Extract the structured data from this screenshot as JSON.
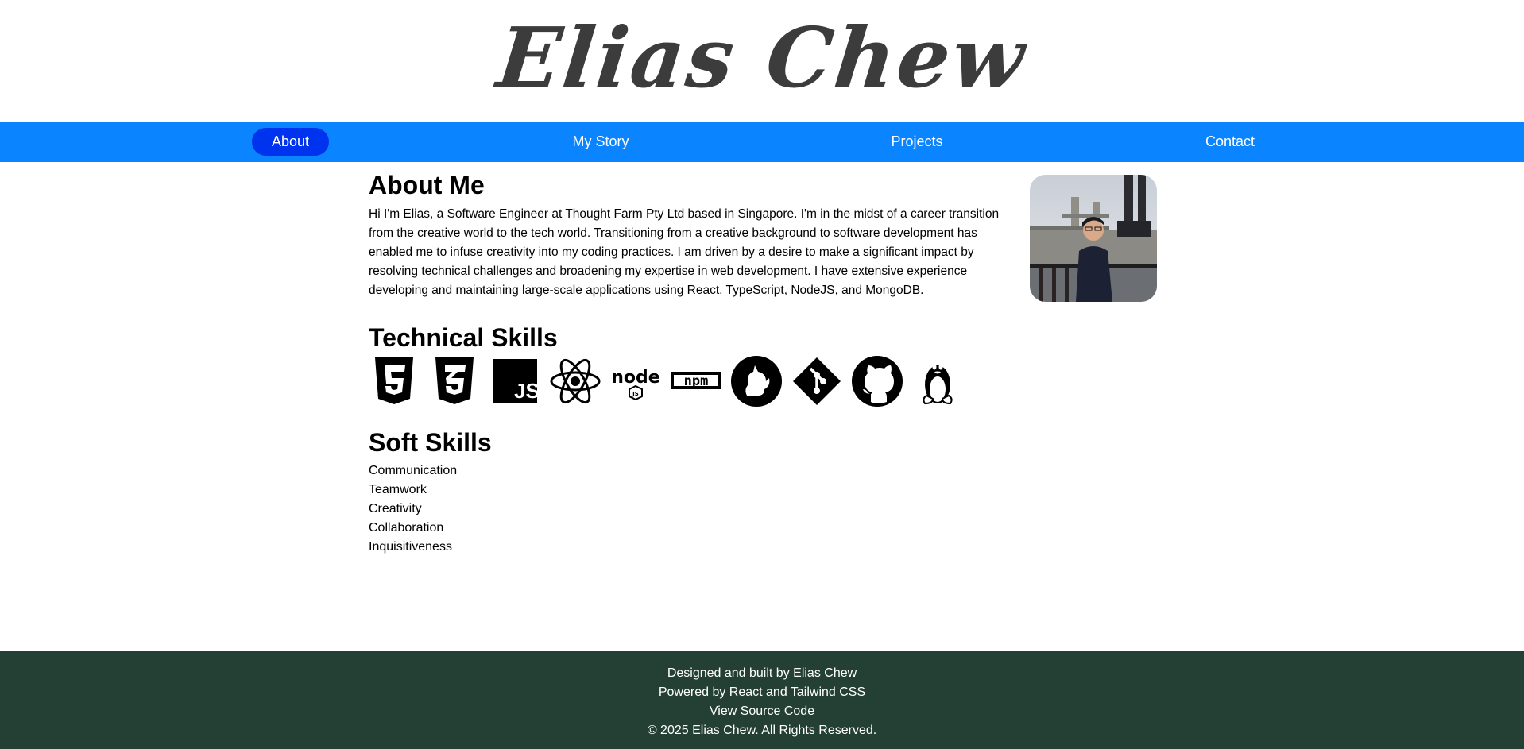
{
  "header": {
    "logo_text": "Elias Chew"
  },
  "nav": {
    "items": [
      {
        "label": "About",
        "active": true
      },
      {
        "label": "My Story",
        "active": false
      },
      {
        "label": "Projects",
        "active": false
      },
      {
        "label": "Contact",
        "active": false
      }
    ],
    "bar_color": "#0a84ff",
    "active_color": "#0033ee"
  },
  "about": {
    "title": "About Me",
    "text": "Hi I'm Elias, a Software Engineer at Thought Farm Pty Ltd based in Singapore. I'm in the midst of a career transition from the creative world to the tech world. Transitioning from a creative background to software development has enabled me to infuse creativity into my coding practices. I am driven by a desire to make a significant impact by resolving technical challenges and broadening my expertise in web development. I have extensive experience developing and maintaining large-scale applications using React, TypeScript, NodeJS, and MongoDB."
  },
  "technical_skills": {
    "title": "Technical Skills",
    "icons": [
      "html5-icon",
      "css3-icon",
      "javascript-icon",
      "react-icon",
      "nodejs-icon",
      "npm-icon",
      "yarn-icon",
      "git-icon",
      "github-icon",
      "linux-tux-icon"
    ],
    "icon_labels": {
      "js": "JS",
      "npm": "npm",
      "node": "node",
      "node_sub": "JS"
    }
  },
  "soft_skills": {
    "title": "Soft Skills",
    "items": [
      "Communication",
      "Teamwork",
      "Creativity",
      "Collaboration",
      "Inquisitiveness"
    ]
  },
  "footer": {
    "line1": "Designed and built by Elias Chew",
    "line2": "Powered by React and Tailwind CSS",
    "source_link": "View Source Code",
    "copyright": "© 2025 Elias Chew. All Rights Reserved.",
    "background": "#243f33"
  }
}
